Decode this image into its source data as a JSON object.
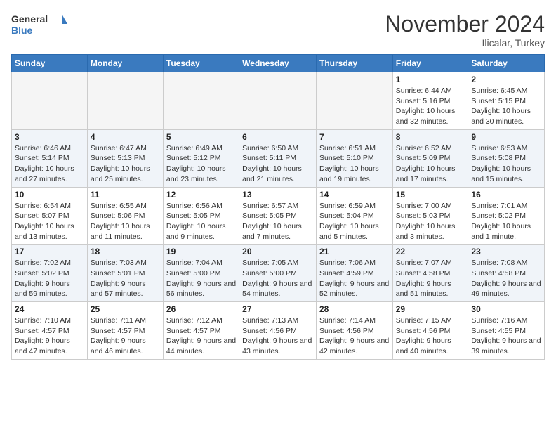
{
  "header": {
    "logo_line1": "General",
    "logo_line2": "Blue",
    "month": "November 2024",
    "location": "Ilicalar, Turkey"
  },
  "days_of_week": [
    "Sunday",
    "Monday",
    "Tuesday",
    "Wednesday",
    "Thursday",
    "Friday",
    "Saturday"
  ],
  "weeks": [
    [
      {
        "day": "",
        "info": ""
      },
      {
        "day": "",
        "info": ""
      },
      {
        "day": "",
        "info": ""
      },
      {
        "day": "",
        "info": ""
      },
      {
        "day": "",
        "info": ""
      },
      {
        "day": "1",
        "info": "Sunrise: 6:44 AM\nSunset: 5:16 PM\nDaylight: 10 hours and 32 minutes."
      },
      {
        "day": "2",
        "info": "Sunrise: 6:45 AM\nSunset: 5:15 PM\nDaylight: 10 hours and 30 minutes."
      }
    ],
    [
      {
        "day": "3",
        "info": "Sunrise: 6:46 AM\nSunset: 5:14 PM\nDaylight: 10 hours and 27 minutes."
      },
      {
        "day": "4",
        "info": "Sunrise: 6:47 AM\nSunset: 5:13 PM\nDaylight: 10 hours and 25 minutes."
      },
      {
        "day": "5",
        "info": "Sunrise: 6:49 AM\nSunset: 5:12 PM\nDaylight: 10 hours and 23 minutes."
      },
      {
        "day": "6",
        "info": "Sunrise: 6:50 AM\nSunset: 5:11 PM\nDaylight: 10 hours and 21 minutes."
      },
      {
        "day": "7",
        "info": "Sunrise: 6:51 AM\nSunset: 5:10 PM\nDaylight: 10 hours and 19 minutes."
      },
      {
        "day": "8",
        "info": "Sunrise: 6:52 AM\nSunset: 5:09 PM\nDaylight: 10 hours and 17 minutes."
      },
      {
        "day": "9",
        "info": "Sunrise: 6:53 AM\nSunset: 5:08 PM\nDaylight: 10 hours and 15 minutes."
      }
    ],
    [
      {
        "day": "10",
        "info": "Sunrise: 6:54 AM\nSunset: 5:07 PM\nDaylight: 10 hours and 13 minutes."
      },
      {
        "day": "11",
        "info": "Sunrise: 6:55 AM\nSunset: 5:06 PM\nDaylight: 10 hours and 11 minutes."
      },
      {
        "day": "12",
        "info": "Sunrise: 6:56 AM\nSunset: 5:05 PM\nDaylight: 10 hours and 9 minutes."
      },
      {
        "day": "13",
        "info": "Sunrise: 6:57 AM\nSunset: 5:05 PM\nDaylight: 10 hours and 7 minutes."
      },
      {
        "day": "14",
        "info": "Sunrise: 6:59 AM\nSunset: 5:04 PM\nDaylight: 10 hours and 5 minutes."
      },
      {
        "day": "15",
        "info": "Sunrise: 7:00 AM\nSunset: 5:03 PM\nDaylight: 10 hours and 3 minutes."
      },
      {
        "day": "16",
        "info": "Sunrise: 7:01 AM\nSunset: 5:02 PM\nDaylight: 10 hours and 1 minute."
      }
    ],
    [
      {
        "day": "17",
        "info": "Sunrise: 7:02 AM\nSunset: 5:02 PM\nDaylight: 9 hours and 59 minutes."
      },
      {
        "day": "18",
        "info": "Sunrise: 7:03 AM\nSunset: 5:01 PM\nDaylight: 9 hours and 57 minutes."
      },
      {
        "day": "19",
        "info": "Sunrise: 7:04 AM\nSunset: 5:00 PM\nDaylight: 9 hours and 56 minutes."
      },
      {
        "day": "20",
        "info": "Sunrise: 7:05 AM\nSunset: 5:00 PM\nDaylight: 9 hours and 54 minutes."
      },
      {
        "day": "21",
        "info": "Sunrise: 7:06 AM\nSunset: 4:59 PM\nDaylight: 9 hours and 52 minutes."
      },
      {
        "day": "22",
        "info": "Sunrise: 7:07 AM\nSunset: 4:58 PM\nDaylight: 9 hours and 51 minutes."
      },
      {
        "day": "23",
        "info": "Sunrise: 7:08 AM\nSunset: 4:58 PM\nDaylight: 9 hours and 49 minutes."
      }
    ],
    [
      {
        "day": "24",
        "info": "Sunrise: 7:10 AM\nSunset: 4:57 PM\nDaylight: 9 hours and 47 minutes."
      },
      {
        "day": "25",
        "info": "Sunrise: 7:11 AM\nSunset: 4:57 PM\nDaylight: 9 hours and 46 minutes."
      },
      {
        "day": "26",
        "info": "Sunrise: 7:12 AM\nSunset: 4:57 PM\nDaylight: 9 hours and 44 minutes."
      },
      {
        "day": "27",
        "info": "Sunrise: 7:13 AM\nSunset: 4:56 PM\nDaylight: 9 hours and 43 minutes."
      },
      {
        "day": "28",
        "info": "Sunrise: 7:14 AM\nSunset: 4:56 PM\nDaylight: 9 hours and 42 minutes."
      },
      {
        "day": "29",
        "info": "Sunrise: 7:15 AM\nSunset: 4:56 PM\nDaylight: 9 hours and 40 minutes."
      },
      {
        "day": "30",
        "info": "Sunrise: 7:16 AM\nSunset: 4:55 PM\nDaylight: 9 hours and 39 minutes."
      }
    ]
  ]
}
